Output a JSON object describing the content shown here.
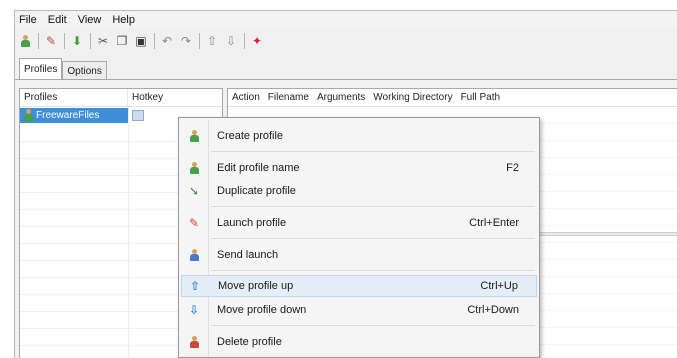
{
  "menubar": {
    "items": [
      "File",
      "Edit",
      "View",
      "Help"
    ]
  },
  "toolbar": {
    "icons": [
      "profile-icon",
      "launch-icon",
      "add-icon",
      "cut-icon",
      "copy-icon",
      "paste-icon",
      "undo-icon",
      "redo-icon",
      "up-arrow-icon",
      "down-arrow-icon",
      "pin-icon"
    ]
  },
  "tabs": [
    {
      "label": "Profiles",
      "active": true
    },
    {
      "label": "Options",
      "active": false
    }
  ],
  "profiles_pane": {
    "col_profiles": "Profiles",
    "col_hotkey": "Hotkey",
    "rows": [
      {
        "name": "FreewareFiles",
        "selected": true
      }
    ]
  },
  "actions_pane": {
    "columns": [
      "Action",
      "Filename",
      "Arguments",
      "Working Directory",
      "Full Path"
    ]
  },
  "context_menu": {
    "items": [
      {
        "label": "Create profile",
        "shortcut": "",
        "icon": "create-profile-icon"
      },
      {
        "label": "Edit profile name",
        "shortcut": "F2",
        "icon": "edit-profile-icon"
      },
      {
        "label": "Duplicate profile",
        "shortcut": "",
        "icon": "duplicate-profile-icon"
      },
      {
        "label": "Launch profile",
        "shortcut": "Ctrl+Enter",
        "icon": "launch-profile-icon"
      },
      {
        "label": "Send launch",
        "shortcut": "",
        "icon": "send-launch-icon"
      },
      {
        "label": "Move profile up",
        "shortcut": "Ctrl+Up",
        "icon": "up-arrow-icon"
      },
      {
        "label": "Move profile down",
        "shortcut": "Ctrl+Down",
        "icon": "down-arrow-icon"
      },
      {
        "label": "Delete profile",
        "shortcut": "",
        "icon": "delete-profile-icon"
      }
    ]
  },
  "colors": {
    "selection": "#3f8fd8",
    "menu_hover": "#e5eef7",
    "arrow_blue": "#3a86d4"
  }
}
